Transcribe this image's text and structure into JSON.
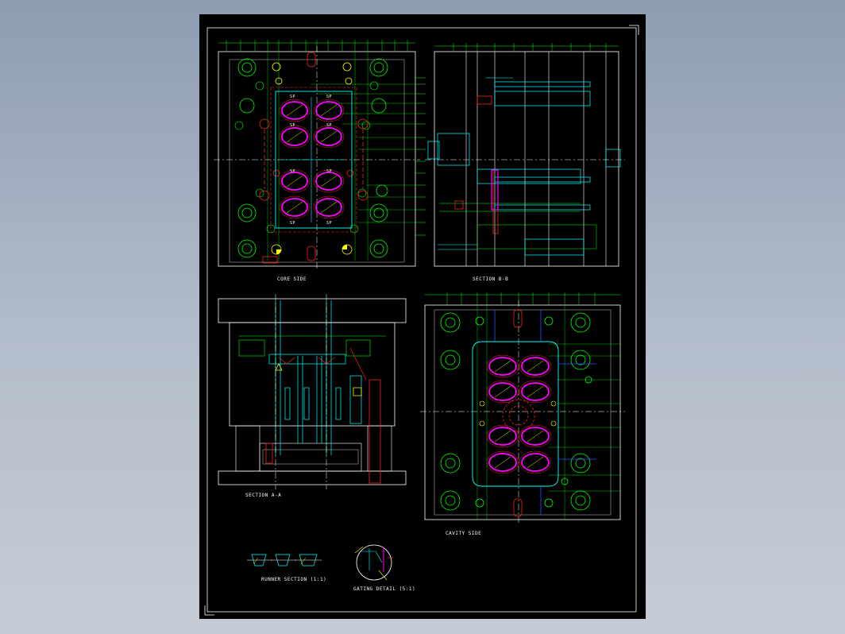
{
  "viewport": {
    "background": "#97a6b9",
    "sheet_background": "#000000"
  },
  "colors": {
    "frame": "#ffffff",
    "green": "#00ff00",
    "cyan": "#00ffff",
    "magenta": "#ff00ff",
    "red": "#ff2020",
    "yellow": "#ffff00",
    "blue": "#3050ff",
    "white": "#ffffff",
    "grey": "#c8c8c8"
  },
  "views": {
    "core_side": {
      "label": "CORE SIDE"
    },
    "section_bb": {
      "label": "SECTION B-B"
    },
    "section_aa": {
      "label": "SECTION A-A"
    },
    "cavity_side": {
      "label": "CAVITY SIDE"
    },
    "runner_section": {
      "label": "RUNNER SECTION (1:1)"
    },
    "gating_detail": {
      "label": "GATING DETAIL (5:1)"
    }
  },
  "cavity_marks": [
    "SP",
    "SP",
    "SP",
    "SP",
    "SP",
    "SP",
    "SP",
    "SP"
  ]
}
